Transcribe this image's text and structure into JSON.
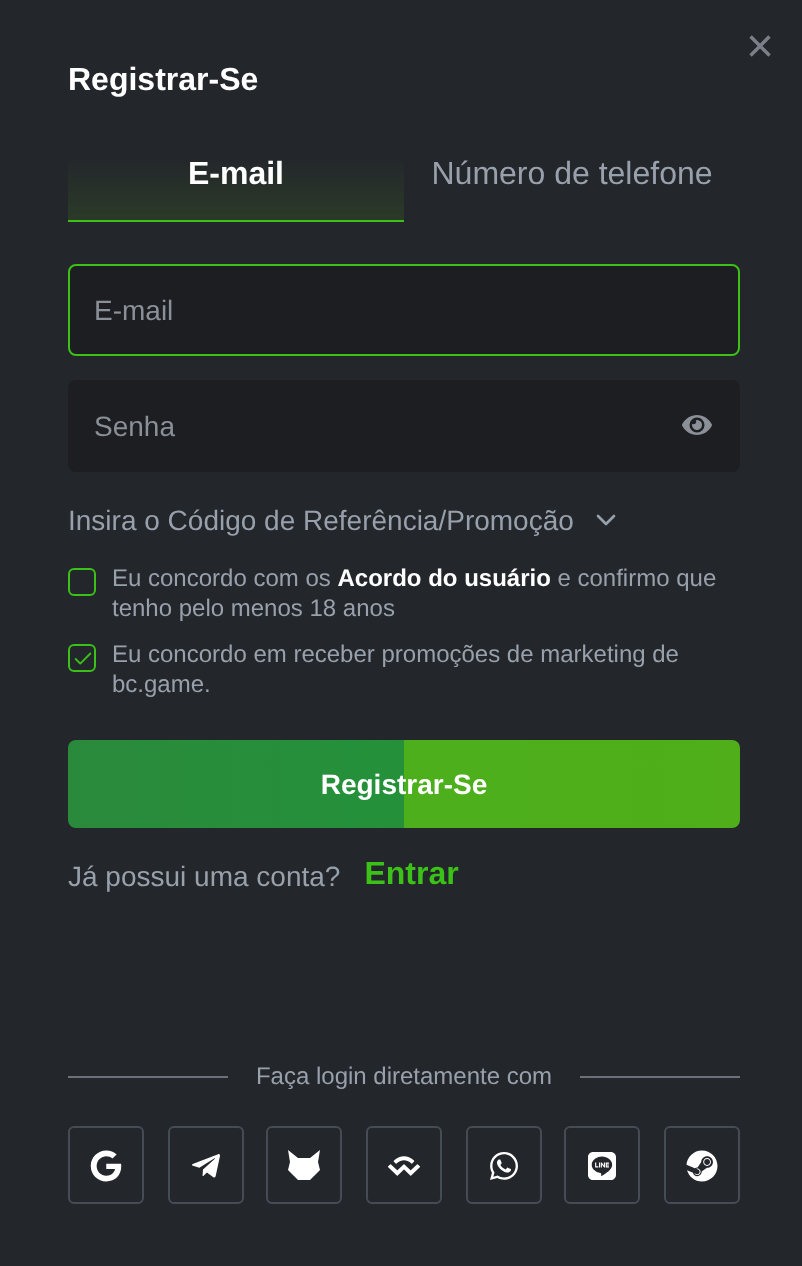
{
  "dialog": {
    "title": "Registrar-Se",
    "close": "×"
  },
  "tabs": [
    {
      "label": "E-mail",
      "selected": true
    },
    {
      "label": "Número de telefone",
      "selected": false
    }
  ],
  "fields": [
    {
      "placeholder": "E-mail",
      "focused": true,
      "kind": "text"
    },
    {
      "placeholder": "Senha",
      "focused": false,
      "kind": "password"
    }
  ],
  "referral": {
    "label": "Insira o Código de Referência/Promoção",
    "expanded": false
  },
  "agreements": [
    {
      "text": "Eu concordo com os **Acordo do usuário** e confirmo que tenho pelo menos 18 anos",
      "checked": false
    },
    {
      "text": "Eu concordo em receber promoções de marketing de bc.game.",
      "checked": true
    }
  ],
  "submit": "Registrar-Se",
  "login_prompt": {
    "text": "Já possui uma conta?",
    "link": "Entrar"
  },
  "social": {
    "label": "Faça login diretamente com",
    "buttons": [
      {
        "kind": "google"
      },
      {
        "kind": "telegram"
      },
      {
        "kind": "fox"
      },
      {
        "kind": "wave"
      },
      {
        "kind": "whatsapp"
      },
      {
        "kind": "line"
      },
      {
        "kind": "steam"
      }
    ]
  }
}
